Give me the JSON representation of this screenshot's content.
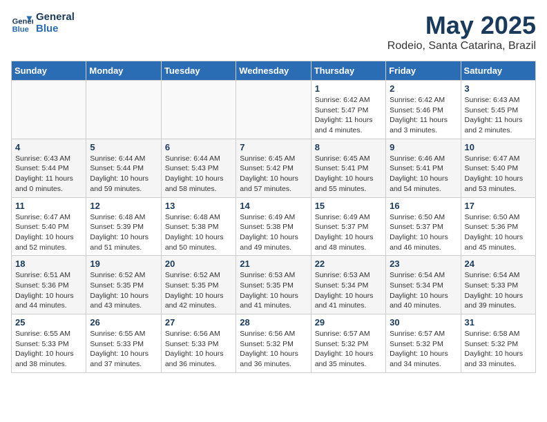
{
  "header": {
    "logo_line1": "General",
    "logo_line2": "Blue",
    "title": "May 2025",
    "subtitle": "Rodeio, Santa Catarina, Brazil"
  },
  "weekdays": [
    "Sunday",
    "Monday",
    "Tuesday",
    "Wednesday",
    "Thursday",
    "Friday",
    "Saturday"
  ],
  "weeks": [
    [
      {
        "day": "",
        "info": ""
      },
      {
        "day": "",
        "info": ""
      },
      {
        "day": "",
        "info": ""
      },
      {
        "day": "",
        "info": ""
      },
      {
        "day": "1",
        "info": "Sunrise: 6:42 AM\nSunset: 5:47 PM\nDaylight: 11 hours and 4 minutes."
      },
      {
        "day": "2",
        "info": "Sunrise: 6:42 AM\nSunset: 5:46 PM\nDaylight: 11 hours and 3 minutes."
      },
      {
        "day": "3",
        "info": "Sunrise: 6:43 AM\nSunset: 5:45 PM\nDaylight: 11 hours and 2 minutes."
      }
    ],
    [
      {
        "day": "4",
        "info": "Sunrise: 6:43 AM\nSunset: 5:44 PM\nDaylight: 11 hours and 0 minutes."
      },
      {
        "day": "5",
        "info": "Sunrise: 6:44 AM\nSunset: 5:44 PM\nDaylight: 10 hours and 59 minutes."
      },
      {
        "day": "6",
        "info": "Sunrise: 6:44 AM\nSunset: 5:43 PM\nDaylight: 10 hours and 58 minutes."
      },
      {
        "day": "7",
        "info": "Sunrise: 6:45 AM\nSunset: 5:42 PM\nDaylight: 10 hours and 57 minutes."
      },
      {
        "day": "8",
        "info": "Sunrise: 6:45 AM\nSunset: 5:41 PM\nDaylight: 10 hours and 55 minutes."
      },
      {
        "day": "9",
        "info": "Sunrise: 6:46 AM\nSunset: 5:41 PM\nDaylight: 10 hours and 54 minutes."
      },
      {
        "day": "10",
        "info": "Sunrise: 6:47 AM\nSunset: 5:40 PM\nDaylight: 10 hours and 53 minutes."
      }
    ],
    [
      {
        "day": "11",
        "info": "Sunrise: 6:47 AM\nSunset: 5:40 PM\nDaylight: 10 hours and 52 minutes."
      },
      {
        "day": "12",
        "info": "Sunrise: 6:48 AM\nSunset: 5:39 PM\nDaylight: 10 hours and 51 minutes."
      },
      {
        "day": "13",
        "info": "Sunrise: 6:48 AM\nSunset: 5:38 PM\nDaylight: 10 hours and 50 minutes."
      },
      {
        "day": "14",
        "info": "Sunrise: 6:49 AM\nSunset: 5:38 PM\nDaylight: 10 hours and 49 minutes."
      },
      {
        "day": "15",
        "info": "Sunrise: 6:49 AM\nSunset: 5:37 PM\nDaylight: 10 hours and 48 minutes."
      },
      {
        "day": "16",
        "info": "Sunrise: 6:50 AM\nSunset: 5:37 PM\nDaylight: 10 hours and 46 minutes."
      },
      {
        "day": "17",
        "info": "Sunrise: 6:50 AM\nSunset: 5:36 PM\nDaylight: 10 hours and 45 minutes."
      }
    ],
    [
      {
        "day": "18",
        "info": "Sunrise: 6:51 AM\nSunset: 5:36 PM\nDaylight: 10 hours and 44 minutes."
      },
      {
        "day": "19",
        "info": "Sunrise: 6:52 AM\nSunset: 5:35 PM\nDaylight: 10 hours and 43 minutes."
      },
      {
        "day": "20",
        "info": "Sunrise: 6:52 AM\nSunset: 5:35 PM\nDaylight: 10 hours and 42 minutes."
      },
      {
        "day": "21",
        "info": "Sunrise: 6:53 AM\nSunset: 5:35 PM\nDaylight: 10 hours and 41 minutes."
      },
      {
        "day": "22",
        "info": "Sunrise: 6:53 AM\nSunset: 5:34 PM\nDaylight: 10 hours and 41 minutes."
      },
      {
        "day": "23",
        "info": "Sunrise: 6:54 AM\nSunset: 5:34 PM\nDaylight: 10 hours and 40 minutes."
      },
      {
        "day": "24",
        "info": "Sunrise: 6:54 AM\nSunset: 5:33 PM\nDaylight: 10 hours and 39 minutes."
      }
    ],
    [
      {
        "day": "25",
        "info": "Sunrise: 6:55 AM\nSunset: 5:33 PM\nDaylight: 10 hours and 38 minutes."
      },
      {
        "day": "26",
        "info": "Sunrise: 6:55 AM\nSunset: 5:33 PM\nDaylight: 10 hours and 37 minutes."
      },
      {
        "day": "27",
        "info": "Sunrise: 6:56 AM\nSunset: 5:33 PM\nDaylight: 10 hours and 36 minutes."
      },
      {
        "day": "28",
        "info": "Sunrise: 6:56 AM\nSunset: 5:32 PM\nDaylight: 10 hours and 36 minutes."
      },
      {
        "day": "29",
        "info": "Sunrise: 6:57 AM\nSunset: 5:32 PM\nDaylight: 10 hours and 35 minutes."
      },
      {
        "day": "30",
        "info": "Sunrise: 6:57 AM\nSunset: 5:32 PM\nDaylight: 10 hours and 34 minutes."
      },
      {
        "day": "31",
        "info": "Sunrise: 6:58 AM\nSunset: 5:32 PM\nDaylight: 10 hours and 33 minutes."
      }
    ]
  ]
}
